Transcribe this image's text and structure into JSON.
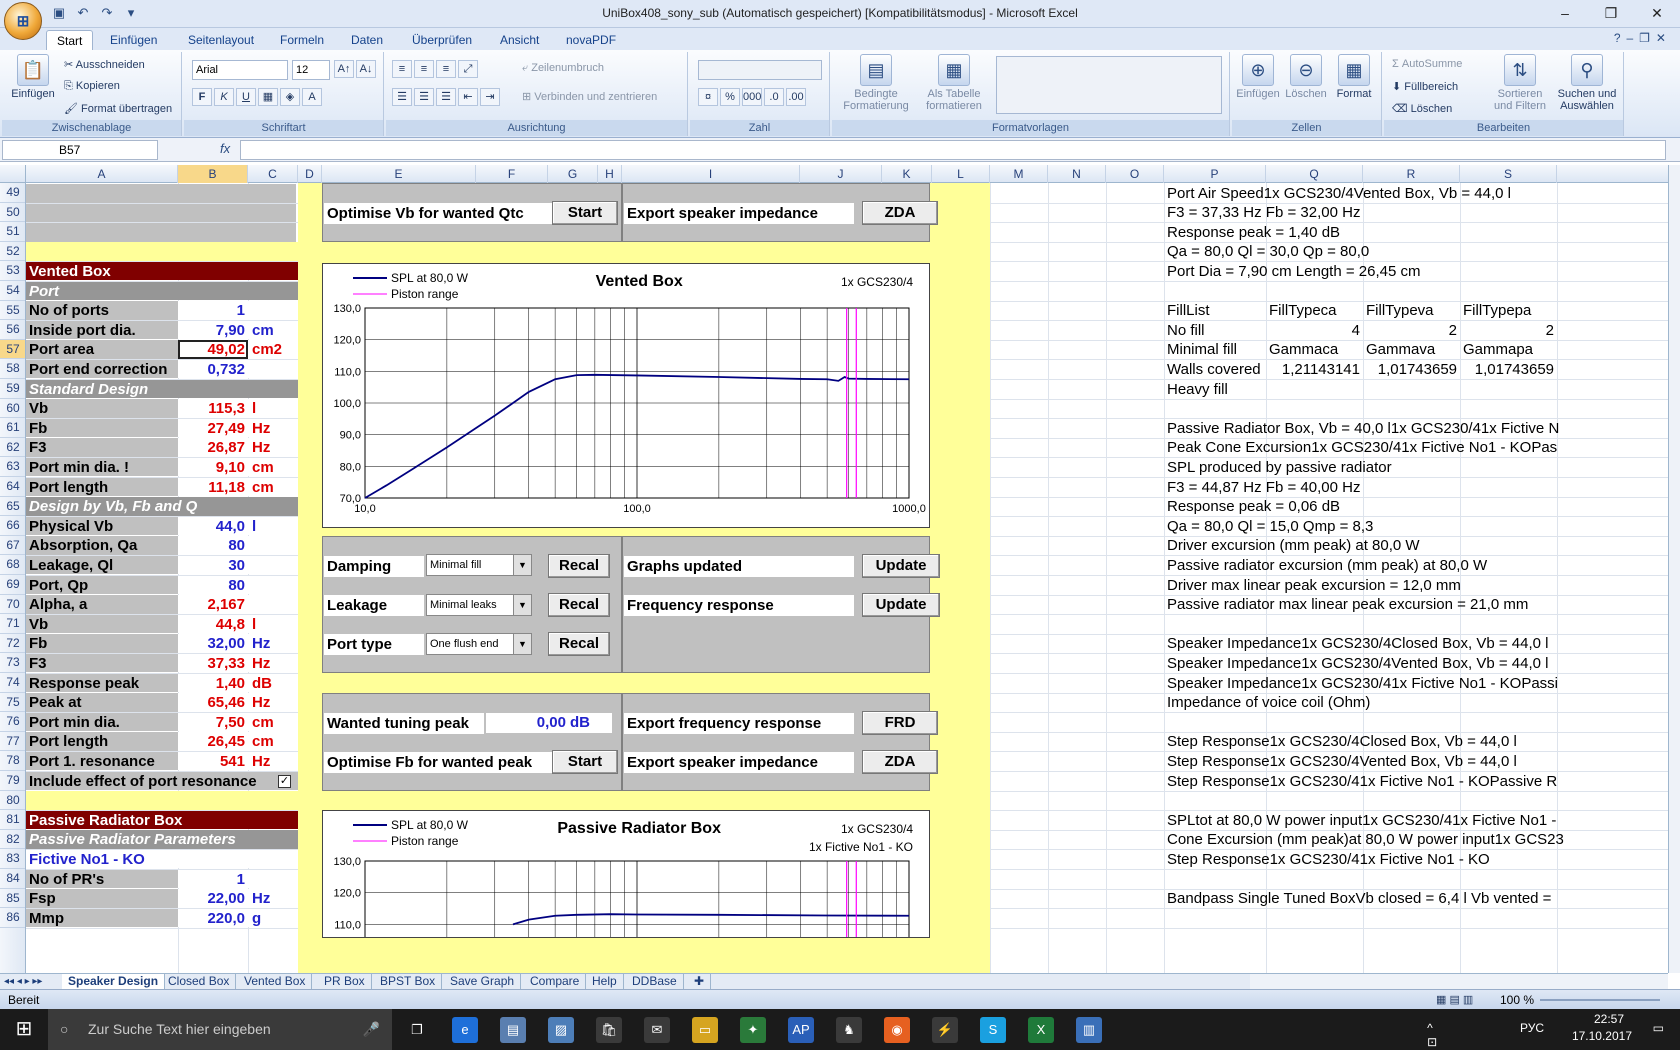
{
  "window": {
    "title": "UniBox408_sony_sub (Automatisch gespeichert)  [Kompatibilitätsmodus] - Microsoft Excel",
    "minimize": "–",
    "restore": "❐",
    "close": "✕"
  },
  "ribbon": {
    "tabs": [
      "Start",
      "Einfügen",
      "Seitenlayout",
      "Formeln",
      "Daten",
      "Überprüfen",
      "Ansicht",
      "novaPDF"
    ],
    "clipboard": {
      "paste": "Einfügen",
      "cut": "Ausschneiden",
      "copy": "Kopieren",
      "format": "Format übertragen",
      "label": "Zwischenablage"
    },
    "font": {
      "name": "Arial",
      "size": "12",
      "label": "Schriftart",
      "bold": "F",
      "italic": "K",
      "underline": "U"
    },
    "alignment": {
      "wrap": "Zeilenumbruch",
      "merge": "Verbinden und zentrieren",
      "label": "Ausrichtung"
    },
    "number": {
      "label": "Zahl"
    },
    "styles": {
      "conditional": "Bedingte Formatierung",
      "table": "Als Tabelle formatieren",
      "label": "Formatvorlagen"
    },
    "cells": {
      "insert": "Einfügen",
      "delete": "Löschen",
      "format": "Format",
      "label": "Zellen"
    },
    "edit": {
      "autosum": "AutoSumme",
      "fill": "Füllbereich",
      "clear": "Löschen",
      "sort": "Sortieren und Filtern",
      "find": "Suchen und Auswählen",
      "label": "Bearbeiten"
    }
  },
  "formula_bar": {
    "name_box": "B57",
    "fx": "fx",
    "formula": ""
  },
  "columns": [
    "A",
    "B",
    "C",
    "D",
    "E",
    "F",
    "G",
    "H",
    "I",
    "J",
    "K",
    "L",
    "M",
    "N",
    "O",
    "P",
    "Q",
    "R",
    "S"
  ],
  "rows": [
    "49",
    "50",
    "51",
    "52",
    "53",
    "54",
    "55",
    "56",
    "57",
    "58",
    "59",
    "60",
    "61",
    "62",
    "63",
    "64",
    "65",
    "66",
    "67",
    "68",
    "69",
    "70",
    "71",
    "72",
    "73",
    "74",
    "75",
    "76",
    "77",
    "78",
    "79",
    "80",
    "81",
    "82",
    "83",
    "84",
    "85",
    "86"
  ],
  "left_panel": [
    {
      "label": "Vented Box",
      "kind": "sec"
    },
    {
      "label": "Port",
      "kind": "sub"
    },
    {
      "label": "No of ports",
      "value": "1",
      "unit": "",
      "color": "blue"
    },
    {
      "label": "Inside port dia.",
      "value": "7,90",
      "unit": "cm",
      "color": "blue"
    },
    {
      "label": "Port area",
      "value": "49,02",
      "unit": "cm2",
      "color": "red"
    },
    {
      "label": "Port end correction",
      "value": "0,732",
      "unit": "",
      "color": "blue"
    },
    {
      "label": "Standard Design",
      "kind": "sub"
    },
    {
      "label": "Vb",
      "value": "115,3",
      "unit": "l",
      "color": "red"
    },
    {
      "label": "Fb",
      "value": "27,49",
      "unit": "Hz",
      "color": "red"
    },
    {
      "label": "F3",
      "value": "26,87",
      "unit": "Hz",
      "color": "red"
    },
    {
      "label": "Port min dia. !",
      "value": "9,10",
      "unit": "cm",
      "color": "red"
    },
    {
      "label": "Port length",
      "value": "11,18",
      "unit": "cm",
      "color": "red"
    },
    {
      "label": "Design by Vb, Fb and Q",
      "kind": "sub"
    },
    {
      "label": "Physical Vb",
      "value": "44,0",
      "unit": "l",
      "color": "blue"
    },
    {
      "label": "Absorption, Qa",
      "value": "80",
      "unit": "",
      "color": "blue"
    },
    {
      "label": "Leakage, Ql",
      "value": "30",
      "unit": "",
      "color": "blue"
    },
    {
      "label": "Port, Qp",
      "value": "80",
      "unit": "",
      "color": "blue"
    },
    {
      "label": "Alpha, a",
      "value": "2,167",
      "unit": "",
      "color": "red"
    },
    {
      "label": "Vb",
      "value": "44,8",
      "unit": "l",
      "color": "red"
    },
    {
      "label": "Fb",
      "value": "32,00",
      "unit": "Hz",
      "color": "blue"
    },
    {
      "label": "F3",
      "value": "37,33",
      "unit": "Hz",
      "color": "red"
    },
    {
      "label": "Response peak",
      "value": "1,40",
      "unit": "dB",
      "color": "red"
    },
    {
      "label": "Peak at",
      "value": "65,46",
      "unit": "Hz",
      "color": "red"
    },
    {
      "label": "Port min dia.",
      "value": "7,50",
      "unit": "cm",
      "color": "red"
    },
    {
      "label": "Port length",
      "value": "26,45",
      "unit": "cm",
      "color": "red"
    },
    {
      "label": "Port 1. resonance",
      "value": "541",
      "unit": "Hz",
      "color": "red"
    },
    {
      "label": "Include effect of port resonance",
      "kind": "check"
    }
  ],
  "left_panel2": [
    {
      "label": "Passive Radiator Box",
      "kind": "sec"
    },
    {
      "label": "Passive Radiator Parameters",
      "kind": "sub"
    },
    {
      "label": "Fictive No1 - KO",
      "kind": "name"
    },
    {
      "label": "No of PR's",
      "value": "1",
      "unit": "",
      "color": "blue"
    },
    {
      "label": "Fsp",
      "value": "22,00",
      "unit": "Hz",
      "color": "blue"
    },
    {
      "label": "Mmp",
      "value": "220,0",
      "unit": "g",
      "color": "blue"
    }
  ],
  "check_mark": "✓",
  "controls": {
    "opt_vb": "Optimise Vb for wanted Qtc",
    "start": "Start",
    "export_imp": "Export speaker impedance",
    "zda": "ZDA",
    "damping": "Damping",
    "damping_val": "Minimal fill",
    "recal": "Recal",
    "leakage": "Leakage",
    "leakage_val": "Minimal leaks",
    "port_type": "Port type",
    "port_type_val": "One flush end",
    "graphs_updated": "Graphs updated",
    "update": "Update",
    "freq_resp": "Frequency response",
    "wanted_peak": "Wanted tuning peak",
    "wanted_peak_val": "0,00",
    "wanted_peak_unit": "dB",
    "export_freq": "Export frequency response",
    "frd": "FRD",
    "opt_fb": "Optimise Fb for wanted peak"
  },
  "right_text": [
    {
      "row": 0,
      "text": "Port Air Speed1x GCS230/4Vented Box, Vb = 44,0 l"
    },
    {
      "row": 1,
      "text": "F3 = 37,33 Hz  Fb = 32,00 Hz"
    },
    {
      "row": 2,
      "text": "Response peak = 1,40 dB"
    },
    {
      "row": 3,
      "text": "Qa = 80,0  Ql = 30,0  Qp = 80,0"
    },
    {
      "row": 4,
      "text": "Port Dia = 7,90 cm  Length = 26,45 cm"
    },
    {
      "row": 12,
      "text": "Passive Radiator Box, Vb = 40,0 l1x GCS230/41x Fictive N"
    },
    {
      "row": 13,
      "text": "Peak Cone Excursion1x GCS230/41x Fictive No1 - KOPas"
    },
    {
      "row": 14,
      "text": "SPL produced by passive radiator"
    },
    {
      "row": 15,
      "text": "F3 = 44,87 Hz  Fb = 40,00 Hz"
    },
    {
      "row": 16,
      "text": "Response peak = 0,06 dB"
    },
    {
      "row": 17,
      "text": "Qa = 80,0  Ql = 15,0  Qmp = 8,3"
    },
    {
      "row": 18,
      "text": "Driver excursion (mm peak) at 80,0 W"
    },
    {
      "row": 19,
      "text": "Passive radiator excursion (mm peak) at 80,0 W"
    },
    {
      "row": 20,
      "text": "Driver max linear peak excursion = 12,0 mm"
    },
    {
      "row": 21,
      "text": "Passive radiator max linear peak excursion = 21,0 mm"
    },
    {
      "row": 23,
      "text": "Speaker Impedance1x GCS230/4Closed Box, Vb = 44,0 l"
    },
    {
      "row": 24,
      "text": "Speaker Impedance1x GCS230/4Vented Box, Vb = 44,0 l"
    },
    {
      "row": 25,
      "text": "Speaker Impedance1x GCS230/41x Fictive No1 - KOPassi"
    },
    {
      "row": 26,
      "text": "Impedance of voice coil (Ohm)"
    },
    {
      "row": 28,
      "text": "Step Response1x GCS230/4Closed Box, Vb = 44,0 l"
    },
    {
      "row": 29,
      "text": "Step Response1x GCS230/4Vented Box, Vb = 44,0 l"
    },
    {
      "row": 30,
      "text": "Step Response1x GCS230/41x Fictive No1 - KOPassive R"
    },
    {
      "row": 32,
      "text": "SPLtot at 80,0 W power input1x GCS230/41x Fictive No1 -"
    },
    {
      "row": 33,
      "text": "Cone Excursion (mm peak)at 80,0 W power input1x GCS23"
    },
    {
      "row": 34,
      "text": "Step Response1x GCS230/41x Fictive No1 - KO"
    },
    {
      "row": 36,
      "text": "Bandpass Single Tuned BoxVb closed = 6,4 l    Vb vented ="
    }
  ],
  "fill_table": {
    "headers": [
      "FillList",
      "FillTypeca",
      "FillTypeva",
      "FillTypepa"
    ],
    "rows": [
      [
        "No fill",
        "4",
        "2",
        "2"
      ],
      [
        "Minimal fill",
        "Gammaca",
        "Gammava",
        "Gammapa"
      ],
      [
        "Walls covered",
        "1,21143141",
        "1,01743659",
        "1,01743659"
      ],
      [
        "Heavy fill",
        "",
        "",
        ""
      ]
    ]
  },
  "chart_data": [
    {
      "type": "line",
      "title": "Vented Box",
      "subtitle": "1x GCS230/4",
      "legend": [
        "SPL at 80,0 W",
        "Piston range"
      ],
      "x_scale": "log",
      "xlim": [
        10,
        1000
      ],
      "ylim": [
        70,
        130
      ],
      "x_ticks": [
        "10,0",
        "100,0",
        "1000,0"
      ],
      "y_ticks": [
        "70,0",
        "80,0",
        "90,0",
        "100,0",
        "110,0",
        "120,0",
        "130,0"
      ],
      "series": [
        {
          "name": "SPL at 80,0 W",
          "color": "#000080",
          "x": [
            10,
            12,
            15,
            20,
            25,
            30,
            35,
            40,
            50,
            60,
            70,
            100,
            200,
            400,
            500,
            550,
            580,
            600,
            700,
            1000
          ],
          "y": [
            70.0,
            74.0,
            79.2,
            86.0,
            91.5,
            96.0,
            100.0,
            103.5,
            107.5,
            108.8,
            108.9,
            108.7,
            108.2,
            107.6,
            107.5,
            107.0,
            108.2,
            107.7,
            107.6,
            107.5
          ]
        },
        {
          "name": "Piston range",
          "color": "#ff00ff",
          "x": [
            590,
            640
          ],
          "vertical": true
        }
      ],
      "grid": true
    },
    {
      "type": "line",
      "title": "Passive Radiator Box",
      "subtitle": "1x GCS230/4",
      "subtitle2": "1x Fictive No1 - KO",
      "legend": [
        "SPL at 80,0 W",
        "Piston range"
      ],
      "x_scale": "log",
      "xlim": [
        10,
        1000
      ],
      "ylim": [
        70,
        130
      ],
      "y_ticks": [
        "110,0",
        "120,0",
        "130,0"
      ],
      "series": [
        {
          "name": "SPL at 80,0 W",
          "color": "#000080",
          "x": [
            35,
            40,
            50,
            60,
            80,
            100,
            200,
            500,
            1000
          ],
          "y": [
            110.0,
            111.5,
            112.7,
            113.0,
            113.2,
            113.1,
            113.0,
            112.8,
            112.7
          ]
        },
        {
          "name": "Piston range",
          "color": "#ff00ff",
          "x": [
            590,
            640
          ],
          "vertical": true
        }
      ],
      "grid": true
    }
  ],
  "sheet_tabs": [
    "Speaker Design",
    "Closed Box",
    "Vented Box",
    "PR Box",
    "BPST Box",
    "Save Graph",
    "Compare",
    "Help",
    "DDBase"
  ],
  "status": {
    "ready": "Bereit",
    "zoom": "100 %"
  },
  "taskbar": {
    "search_placeholder": "Zur Suche Text hier eingeben",
    "lang": "РУС",
    "time": "22:57",
    "date": "17.10.2017"
  }
}
